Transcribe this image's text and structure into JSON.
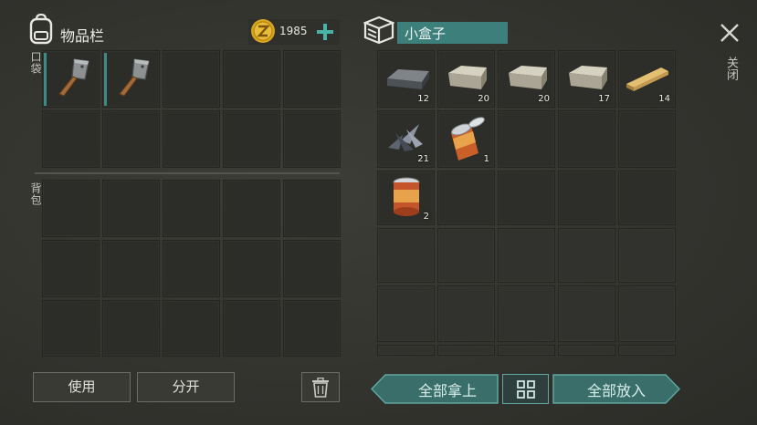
{
  "inventory": {
    "title": "物品栏",
    "coins": "1985",
    "pocket_label": "口袋",
    "backpack_label": "背包"
  },
  "container": {
    "title": "小盒子",
    "close_label": "关闭"
  },
  "inventory_items": [
    {
      "name": "cleaver",
      "selected": true
    },
    {
      "name": "cleaver",
      "selected": true
    }
  ],
  "container_items": [
    {
      "name": "iron-ingot",
      "qty": "12"
    },
    {
      "name": "stone-block",
      "qty": "20"
    },
    {
      "name": "stone-block",
      "qty": "20"
    },
    {
      "name": "stone-block",
      "qty": "17"
    },
    {
      "name": "wooden-plank",
      "qty": "14"
    },
    {
      "name": "scrap-metal",
      "qty": "21"
    },
    {
      "name": "opened-can",
      "qty": "1"
    },
    {
      "name": "canned-food",
      "qty": "2"
    }
  ],
  "buttons": {
    "use": "使用",
    "split": "分开",
    "take_all": "全部拿上",
    "put_all": "全部放入"
  },
  "colors": {
    "accent": "#3f8a86",
    "coin": "#d7a520",
    "plus": "#49b3a7"
  }
}
